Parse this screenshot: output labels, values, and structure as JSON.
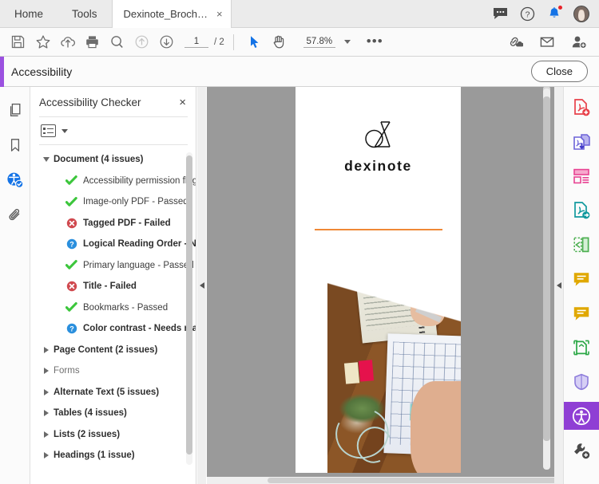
{
  "window": {
    "tabs": [
      {
        "label": "Home",
        "name": "tab-home"
      },
      {
        "label": "Tools",
        "name": "tab-tools"
      },
      {
        "label": "Dexinote_Brochur...",
        "name": "tab-document"
      }
    ],
    "tab_close_glyph": "×",
    "top_right_icons": [
      {
        "name": "comment-icon",
        "title": "Comment"
      },
      {
        "name": "help-icon",
        "title": "Help"
      },
      {
        "name": "bell-icon",
        "title": "Notifications"
      },
      {
        "name": "avatar",
        "title": "Account"
      }
    ]
  },
  "toolbar": {
    "buttons": [
      {
        "name": "save-icon",
        "title": "Save"
      },
      {
        "name": "star-icon",
        "title": "Add to favorites"
      },
      {
        "name": "cloud-upload-icon",
        "title": "Upload to cloud"
      },
      {
        "name": "print-icon",
        "title": "Print"
      },
      {
        "name": "search-icon",
        "title": "Find"
      },
      {
        "name": "previous-page-icon",
        "title": "Previous page"
      },
      {
        "name": "next-page-icon",
        "title": "Next page"
      }
    ],
    "page_current": "1",
    "page_total": "/ 2",
    "select_tool": "select-cursor-icon",
    "hand_tool": "hand-icon",
    "zoom_level": "57.8%",
    "more_tools": "•••",
    "right_buttons": [
      {
        "name": "share-link-icon",
        "title": "Share link"
      },
      {
        "name": "email-icon",
        "title": "Send by email"
      },
      {
        "name": "add-person-icon",
        "title": "Add recipient"
      }
    ]
  },
  "accessibility_bar": {
    "title": "Accessibility",
    "close_label": "Close",
    "accent_color": "#9b51e0"
  },
  "left_rail": [
    {
      "name": "page-thumbnails-icon",
      "title": "Page Thumbnails",
      "active": false
    },
    {
      "name": "bookmarks-icon",
      "title": "Bookmarks",
      "active": false
    },
    {
      "name": "accessibility-checker-icon",
      "title": "Accessibility Checker",
      "active": true
    },
    {
      "name": "attachments-icon",
      "title": "Attachments",
      "active": false
    }
  ],
  "panel": {
    "title": "Accessibility Checker",
    "close_glyph": "×",
    "options_icon": "list-options-icon",
    "tree": [
      {
        "label": "Document (4 issues)",
        "level": 0,
        "expanded": true,
        "status": "group",
        "bold": true
      },
      {
        "label": "Accessibility permission flag -",
        "level": 1,
        "status": "passed",
        "bold": false
      },
      {
        "label": "Image-only PDF - Passed",
        "level": 1,
        "status": "passed",
        "bold": false
      },
      {
        "label": "Tagged PDF - Failed",
        "level": 1,
        "status": "failed",
        "bold": true
      },
      {
        "label": "Logical Reading Order - Nee",
        "level": 1,
        "status": "needs-check",
        "bold": true
      },
      {
        "label": "Primary language - Passed",
        "level": 1,
        "status": "passed",
        "bold": false
      },
      {
        "label": "Title - Failed",
        "level": 1,
        "status": "failed",
        "bold": true
      },
      {
        "label": "Bookmarks - Passed",
        "level": 1,
        "status": "passed",
        "bold": false
      },
      {
        "label": "Color contrast - Needs manu",
        "level": 1,
        "status": "needs-check",
        "bold": true
      },
      {
        "label": "Page Content (2 issues)",
        "level": 0,
        "expanded": false,
        "status": "group",
        "bold": true
      },
      {
        "label": "Forms",
        "level": 0,
        "expanded": false,
        "status": "group",
        "bold": false
      },
      {
        "label": "Alternate Text (5 issues)",
        "level": 0,
        "expanded": false,
        "status": "group",
        "bold": true
      },
      {
        "label": "Tables (4 issues)",
        "level": 0,
        "expanded": false,
        "status": "group",
        "bold": true
      },
      {
        "label": "Lists (2 issues)",
        "level": 0,
        "expanded": false,
        "status": "group",
        "bold": true
      },
      {
        "label": "Headings (1 issue)",
        "level": 0,
        "expanded": false,
        "status": "group",
        "bold": true
      }
    ],
    "status_colors": {
      "passed": "#3cc63c",
      "failed": "#d0494f",
      "needs-check": "#2a8fdd"
    }
  },
  "document": {
    "brand_name": "dexinote",
    "logo_icon": "dexinote-monogram-icon",
    "rule_color": "#ef8836",
    "photo_alt": "architect-desk-photo"
  },
  "right_rail": [
    {
      "name": "create-pdf-icon",
      "title": "Create PDF",
      "color": "#e8414a",
      "active": false
    },
    {
      "name": "combine-files-icon",
      "title": "Combine Files",
      "color": "#6c63d8",
      "active": false
    },
    {
      "name": "organize-pages-icon",
      "title": "Organize Pages",
      "color": "#e84393",
      "active": false
    },
    {
      "name": "export-pdf-icon",
      "title": "Export PDF",
      "color": "#11999e",
      "active": false
    },
    {
      "name": "edit-pdf-icon",
      "title": "Edit PDF",
      "color": "#4caf50",
      "active": false
    },
    {
      "name": "comment-pdf-icon",
      "title": "Comment",
      "color": "#e0a800",
      "active": false
    },
    {
      "name": "fill-sign-icon",
      "title": "Fill & Sign",
      "color": "#e0a800",
      "active": false
    },
    {
      "name": "scan-ocr-icon",
      "title": "Scan & OCR",
      "color": "#2aa745",
      "active": false
    },
    {
      "name": "protect-icon",
      "title": "Protect",
      "color": "#8e7ddb",
      "active": false
    },
    {
      "name": "accessibility-icon",
      "title": "Accessibility",
      "color": "#ffffff",
      "active": true
    },
    {
      "name": "more-tools-icon",
      "title": "More Tools",
      "color": "#4a4a4a",
      "active": false
    }
  ]
}
